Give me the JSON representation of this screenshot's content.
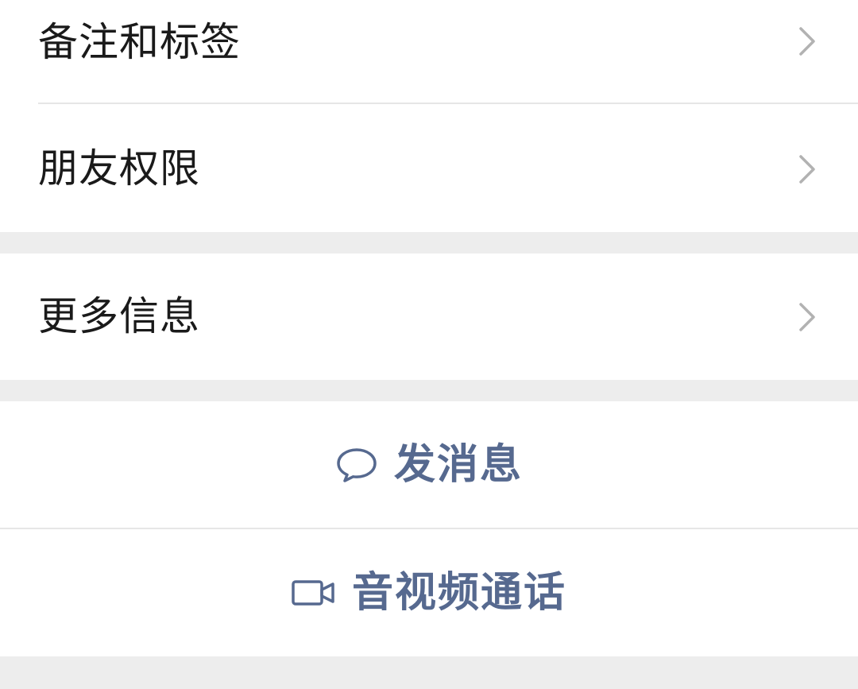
{
  "settings": {
    "items": [
      {
        "label": "备注和标签",
        "icon": "chevron-right-icon"
      },
      {
        "label": "朋友权限",
        "icon": "chevron-right-icon"
      },
      {
        "label": "更多信息",
        "icon": "chevron-right-icon"
      }
    ]
  },
  "actions": {
    "message_label": "发消息",
    "message_icon": "chat-bubble-icon",
    "call_label": "音视频通话",
    "call_icon": "video-camera-icon"
  },
  "colors": {
    "background": "#ededed",
    "surface": "#ffffff",
    "text": "#1a1a1a",
    "action_text": "#56698f",
    "chevron": "#b2b2b2",
    "divider": "#e6e6e6"
  }
}
